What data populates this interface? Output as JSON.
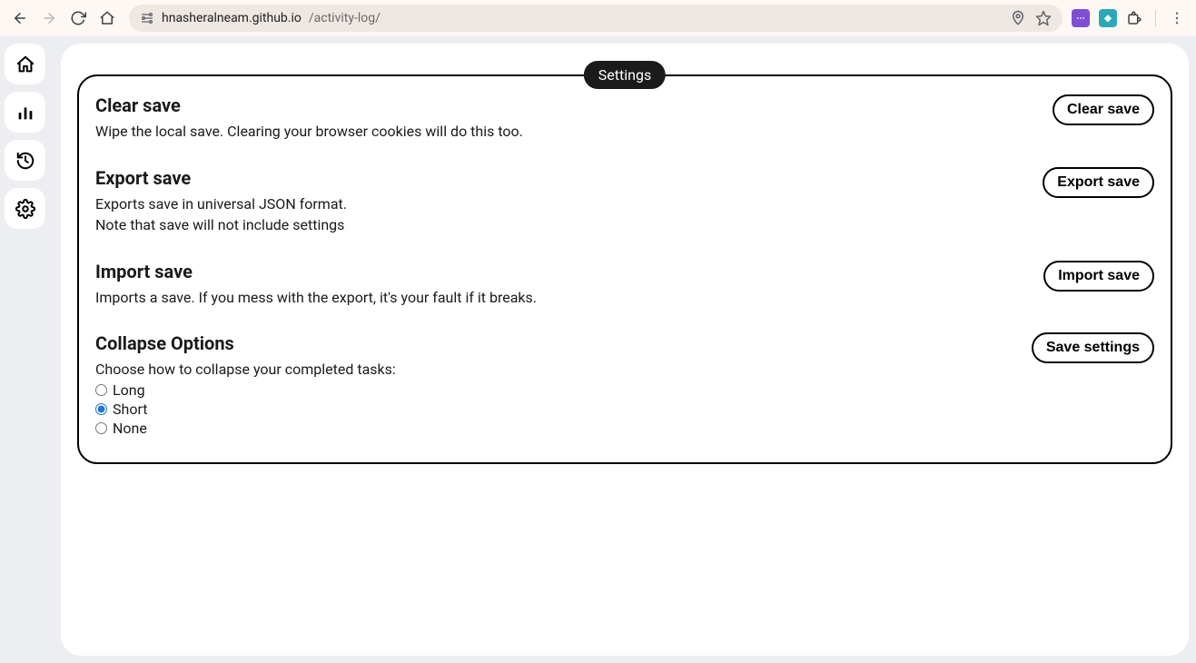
{
  "browser": {
    "url_host": "hnasheralneam.github.io",
    "url_path": "/activity-log/"
  },
  "settings": {
    "legend": "Settings",
    "clear": {
      "title": "Clear save",
      "desc": "Wipe the local save. Clearing your browser cookies will do this too.",
      "button": "Clear save"
    },
    "export": {
      "title": "Export save",
      "desc1": "Exports save in universal JSON format.",
      "desc2": "Note that save will not include settings",
      "button": "Export save"
    },
    "import": {
      "title": "Import save",
      "desc": "Imports a save. If you mess with the export, it's your fault if it breaks.",
      "button": "Import save"
    },
    "collapse": {
      "title": "Collapse Options",
      "desc": "Choose how to collapse your completed tasks:",
      "button": "Save settings",
      "options": {
        "long": "Long",
        "short": "Short",
        "none": "None"
      },
      "selected": "short"
    }
  }
}
